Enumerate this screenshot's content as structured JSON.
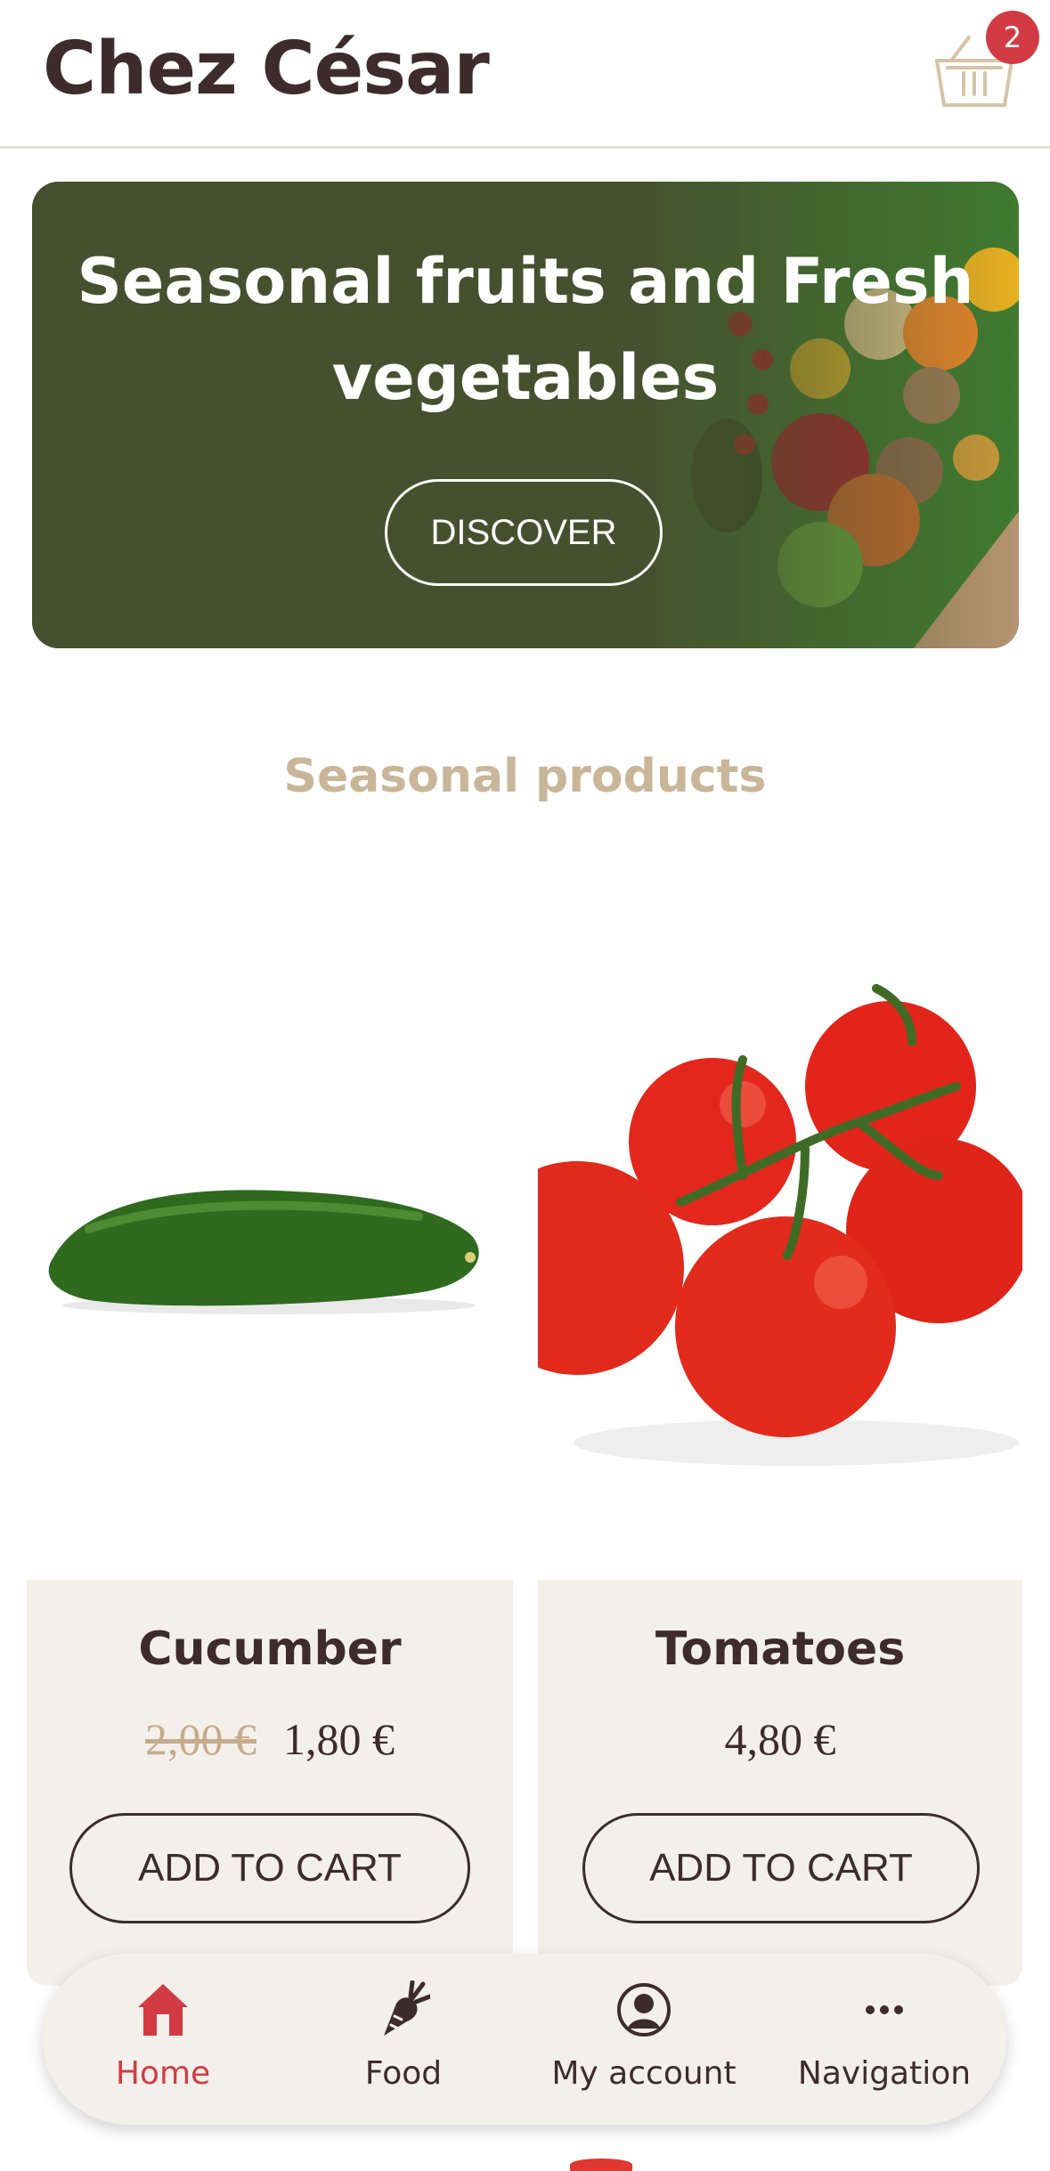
{
  "header": {
    "brand": "Chez César",
    "cart_count": "2",
    "cart_icon": "basket-icon"
  },
  "hero": {
    "title": "Seasonal fruits and Fresh vegetables",
    "button_label": "DISCOVER"
  },
  "section": {
    "title": "Seasonal products"
  },
  "products": [
    {
      "name": "Cucumber",
      "old_price": "2,00 €",
      "price": "1,80 €",
      "button_label": "ADD TO CART",
      "image": "cucumber-image"
    },
    {
      "name": "Tomatoes",
      "price": "4,80 €",
      "button_label": "ADD TO CART",
      "image": "tomatoes-image"
    }
  ],
  "bottom_nav": {
    "items": [
      {
        "label": "Home",
        "icon": "home-icon",
        "active": true
      },
      {
        "label": "Food",
        "icon": "carrot-icon",
        "active": false
      },
      {
        "label": "My account",
        "icon": "user-icon",
        "active": false
      },
      {
        "label": "Navigation",
        "icon": "more-icon",
        "active": false
      }
    ]
  },
  "colors": {
    "brand_text": "#3d2b2e",
    "accent_red": "#d33b44",
    "hero_bg": "#474f2f",
    "section_title": "#c9b598",
    "card_bg": "#f3f0eb"
  }
}
